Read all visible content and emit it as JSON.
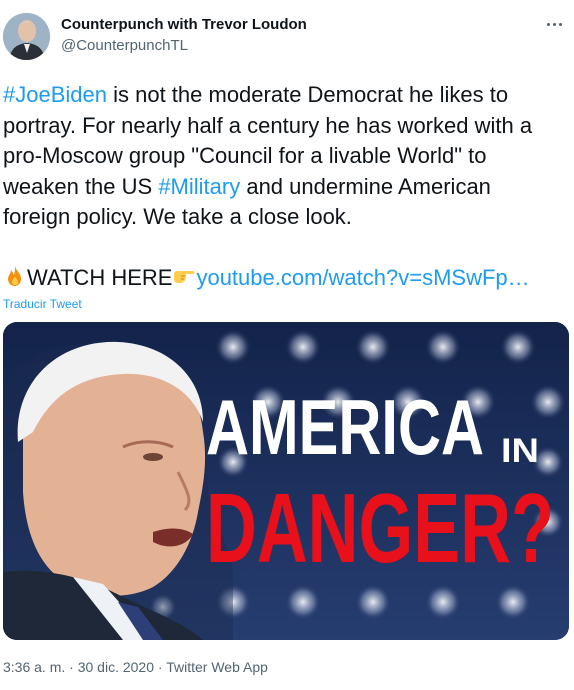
{
  "tweet": {
    "author": {
      "display_name": "Counterpunch with Trevor Loudon",
      "handle": "@CounterpunchTL",
      "avatar_icon": "avatar-photo"
    },
    "more_icon": "more-horizontal-icon",
    "text": {
      "line1": {
        "hashtag": "#JoeBiden",
        "rest": " is not the moderate Democrat he likes to"
      },
      "line2": "portray. For nearly half a century he has worked with a",
      "line3": "pro-Moscow group \"Council for a livable World\" to",
      "line4": {
        "before": "weaken the US ",
        "hashtag": "#Military",
        "after": " and undermine American"
      },
      "line5": "foreign policy. We take a close look.",
      "watch": {
        "fire_emoji": "fire-emoji",
        "label": "WATCH HERE",
        "point_emoji": "backhand-index-pointing-right-emoji",
        "link": "youtube.com/watch?v=sMSwFp…"
      }
    },
    "translate_label": "Traducir Tweet",
    "media": {
      "headline_1": "AMERICA",
      "headline_small": "IN",
      "headline_2": "DANGER?",
      "colors": {
        "background": "#1c2f5a",
        "headline_1": "#ffffff",
        "headline_2": "#e8101a"
      }
    },
    "meta": {
      "time": "3:36 a. m.",
      "sep1": " · ",
      "date": "30 dic. 2020",
      "sep2": " · ",
      "source": "Twitter Web App"
    },
    "colors": {
      "link": "#1d9bf0",
      "secondary": "#536471",
      "text": "#0f1419"
    }
  }
}
